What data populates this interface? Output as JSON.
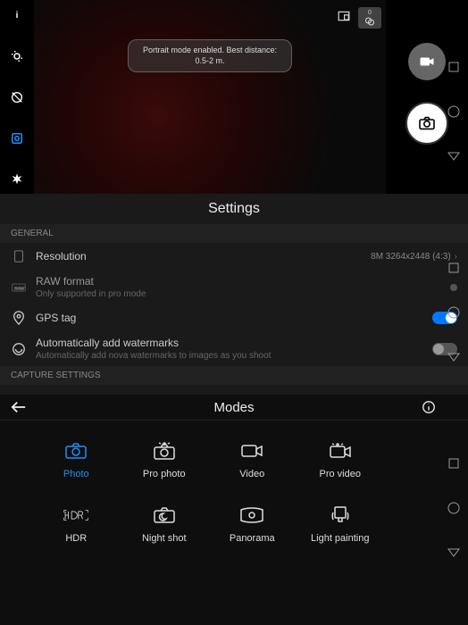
{
  "camera": {
    "toast_line1": "Portrait mode enabled. Best distance:",
    "toast_line2": "0.5-2 m.",
    "top_badge": "0"
  },
  "settings": {
    "title": "Settings",
    "section_general": "GENERAL",
    "section_capture": "CAPTURE SETTINGS",
    "rows": {
      "resolution": {
        "label": "Resolution",
        "value": "8M 3264x2448 (4:3)"
      },
      "raw": {
        "label": "RAW format",
        "sub": "Only supported in pro mode"
      },
      "gps": {
        "label": "GPS tag"
      },
      "watermark": {
        "label": "Automatically add watermarks",
        "sub": "Automatically add nova watermarks to images as you shoot"
      }
    }
  },
  "modes": {
    "title": "Modes",
    "items": [
      {
        "label": "Photo"
      },
      {
        "label": "Pro photo"
      },
      {
        "label": "Video"
      },
      {
        "label": "Pro video"
      },
      {
        "label": "HDR"
      },
      {
        "label": "Night shot"
      },
      {
        "label": "Panorama"
      },
      {
        "label": "Light painting"
      }
    ]
  }
}
